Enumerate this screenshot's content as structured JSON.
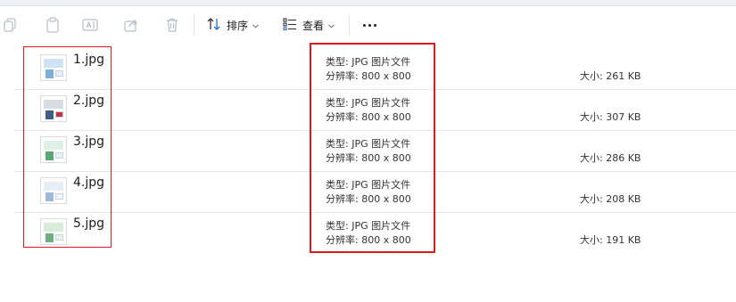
{
  "toolbar": {
    "sort_label": "排序",
    "view_label": "查看",
    "icons": [
      "copy-icon",
      "paste-icon",
      "rename-icon",
      "share-icon",
      "delete-icon",
      "sort-icon",
      "view-icon",
      "more-icon"
    ]
  },
  "files": [
    {
      "name": "1.jpg",
      "type_label": "类型: JPG 图片文件",
      "resolution_label": "分辨率: 800 x 800",
      "size_label": "大小: 261 KB",
      "thumb_colors": [
        "#cfe3f5",
        "#7fb0d9",
        "#e6eef6"
      ]
    },
    {
      "name": "2.jpg",
      "type_label": "类型: JPG 图片文件",
      "resolution_label": "分辨率: 800 x 800",
      "size_label": "大小: 307 KB",
      "thumb_colors": [
        "#d8dde3",
        "#3d5f86",
        "#c9313c"
      ]
    },
    {
      "name": "3.jpg",
      "type_label": "类型: JPG 图片文件",
      "resolution_label": "分辨率: 800 x 800",
      "size_label": "大小: 286 KB",
      "thumb_colors": [
        "#dff0e4",
        "#5aa777",
        "#e9f2ec"
      ]
    },
    {
      "name": "4.jpg",
      "type_label": "类型: JPG 图片文件",
      "resolution_label": "分辨率: 800 x 800",
      "size_label": "大小: 208 KB",
      "thumb_colors": [
        "#e8eef6",
        "#9fb9d6",
        "#f4f7fb"
      ]
    },
    {
      "name": "5.jpg",
      "type_label": "类型: JPG 图片文件",
      "resolution_label": "分辨率: 800 x 800",
      "size_label": "大小: 191 KB",
      "thumb_colors": [
        "#d9ecd9",
        "#6fae7e",
        "#e7f3ea"
      ]
    }
  ],
  "highlight_color": "#e0191b"
}
